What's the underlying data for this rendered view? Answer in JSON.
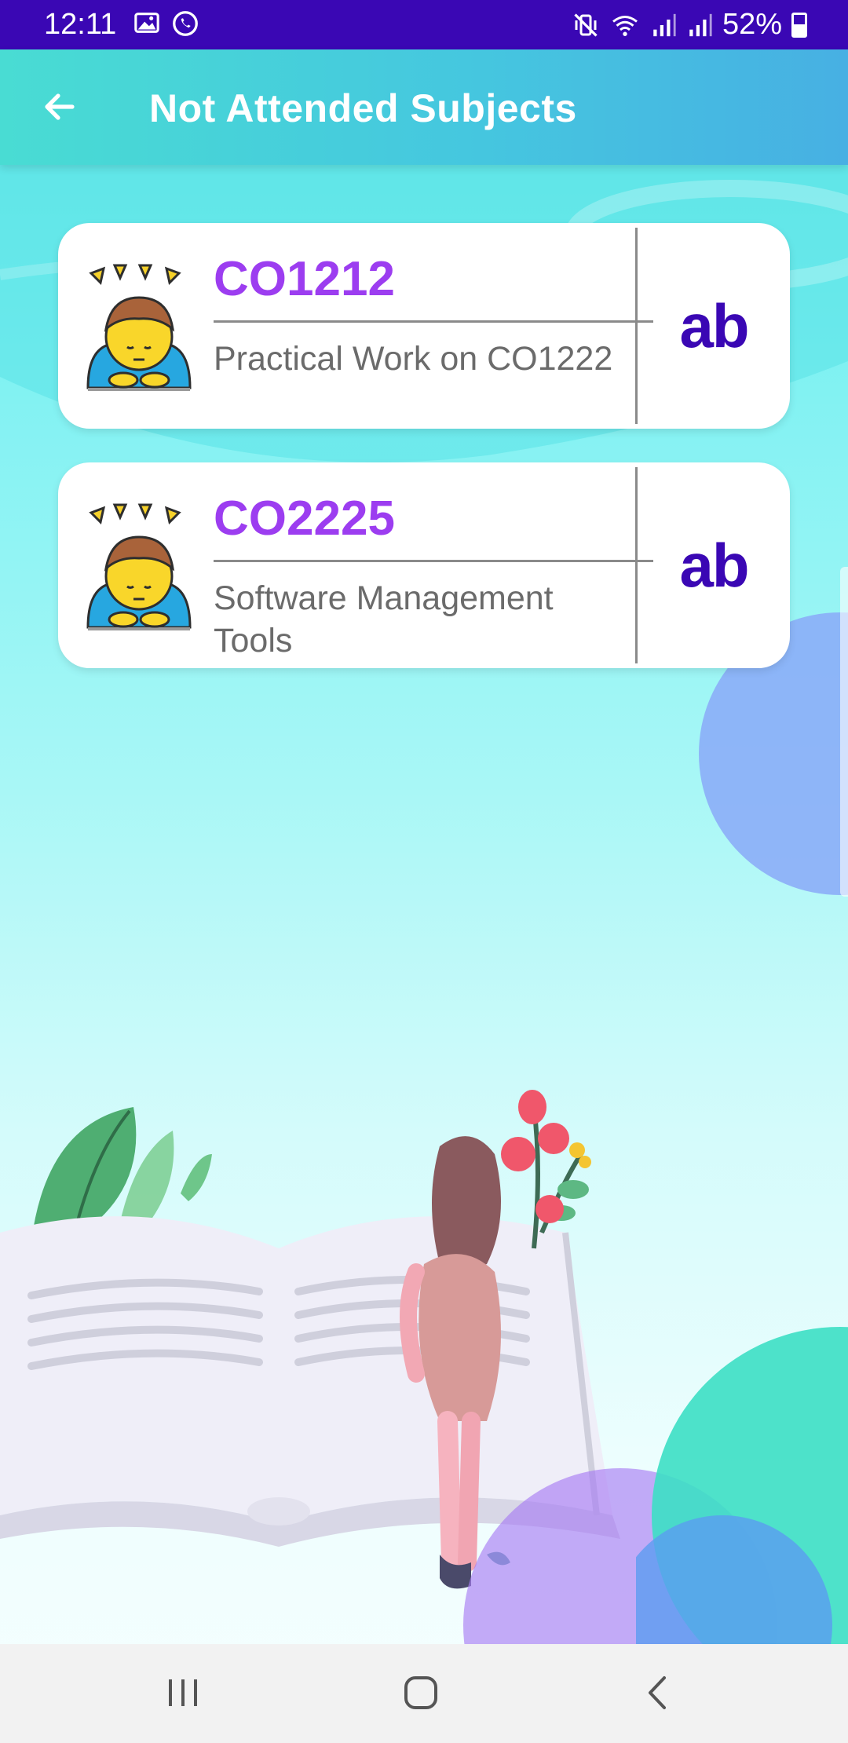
{
  "status_bar": {
    "time": "12:11",
    "battery": "52%",
    "icons": [
      "image-icon",
      "whatsapp-icon",
      "mute-vibrate-icon",
      "wifi-icon",
      "signal-icon",
      "signal-icon",
      "battery-icon"
    ]
  },
  "app_bar": {
    "title": "Not Attended Subjects"
  },
  "subjects": [
    {
      "code": "CO1212",
      "name": "Practical Work on CO1222",
      "badge": "ab"
    },
    {
      "code": "CO2225",
      "name": "Software Management Tools",
      "badge": "ab"
    }
  ],
  "colors": {
    "status_bar": "#3a07b4",
    "code_text": "#9c3df0",
    "badge_text": "#3a07b4"
  }
}
